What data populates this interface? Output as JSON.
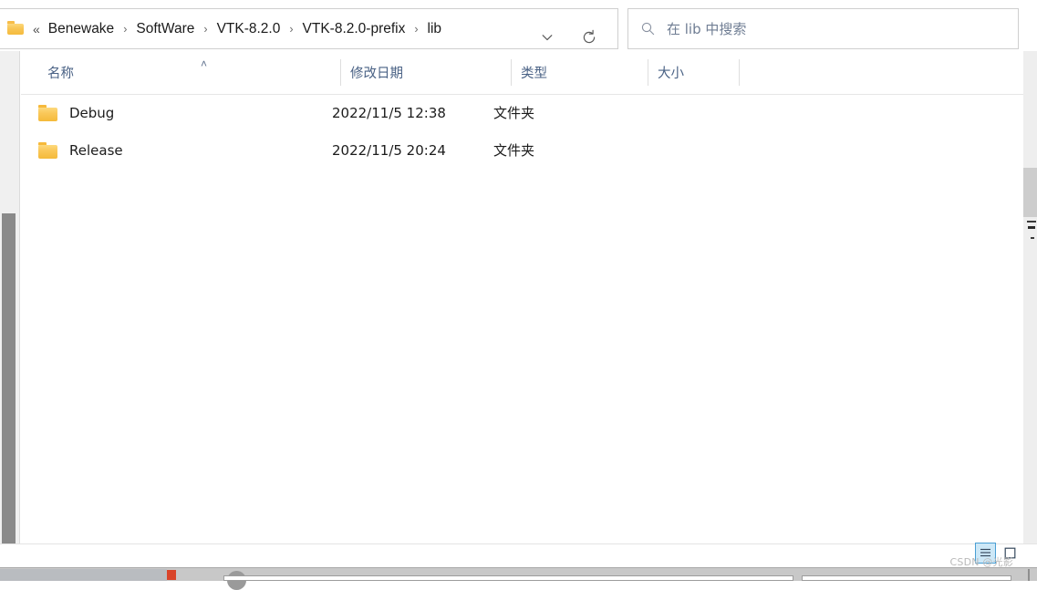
{
  "address_bar": {
    "folder_icon": "folder-icon",
    "overflow_indicator": "«",
    "breadcrumbs": [
      {
        "label": "Benewake"
      },
      {
        "label": "SoftWare"
      },
      {
        "label": "VTK-8.2.0"
      },
      {
        "label": "VTK-8.2.0-prefix"
      },
      {
        "label": "lib"
      }
    ],
    "separator": "›",
    "dropdown_icon": "chevron-down-icon",
    "refresh_icon": "refresh-icon"
  },
  "search": {
    "icon": "search-icon",
    "placeholder": "在 lib 中搜索",
    "value": ""
  },
  "columns": [
    {
      "key": "name",
      "label": "名称",
      "sorted": true,
      "sort_direction": "asc",
      "sort_caret": "˄"
    },
    {
      "key": "date",
      "label": "修改日期",
      "sorted": false
    },
    {
      "key": "type",
      "label": "类型",
      "sorted": false
    },
    {
      "key": "size",
      "label": "大小",
      "sorted": false
    }
  ],
  "rows": [
    {
      "icon": "folder-icon",
      "name": "Debug",
      "date": "2022/11/5 12:38",
      "type": "文件夹",
      "size": ""
    },
    {
      "icon": "folder-icon",
      "name": "Release",
      "date": "2022/11/5 20:24",
      "type": "文件夹",
      "size": ""
    }
  ],
  "statusbar": {
    "details_view_button": "details-view",
    "large-icons_view_button": "large-icons-view",
    "selected_view": "details-view",
    "watermark": "CSDN @光影"
  },
  "colors": {
    "accent": "#4a9fd4",
    "accent_fill": "#cde8f7",
    "header_text": "#4a6285",
    "folder": "#f8c555",
    "border": "#cfcfcf"
  }
}
